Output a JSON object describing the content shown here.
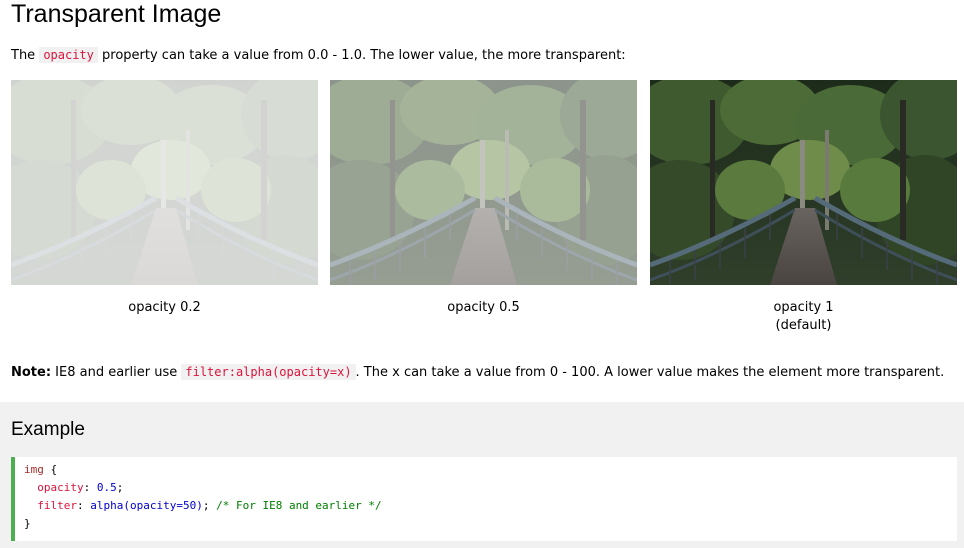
{
  "page": {
    "title": "Transparent Image",
    "intro_before": "The ",
    "intro_code": "opacity",
    "intro_after": " property can take a value from 0.0 - 1.0. The lower value, the more transparent:"
  },
  "images": [
    {
      "opacity": 0.2,
      "caption_line1": "opacity 0.2",
      "caption_line2": ""
    },
    {
      "opacity": 0.5,
      "caption_line1": "opacity 0.5",
      "caption_line2": ""
    },
    {
      "opacity": 1.0,
      "caption_line1": "opacity 1",
      "caption_line2": "(default)"
    }
  ],
  "note": {
    "label": "Note:",
    "text_before": " IE8 and earlier use ",
    "code": "filter:alpha(opacity=x)",
    "text_after": ". The x can take a value from 0 - 100. A lower value makes the element more transparent."
  },
  "example": {
    "title": "Example",
    "line1_selector": "img",
    "line1_brace": " {",
    "line2_indent": "  ",
    "line2_prop": "opacity",
    "line2_colon": ": ",
    "line2_val": "0.5",
    "line2_end": ";",
    "line3_indent": "  ",
    "line3_prop": "filter",
    "line3_colon": ": ",
    "line3_val": "alpha(opacity=50)",
    "line3_semi": "; ",
    "line3_comment": "/* For IE8 and earlier */",
    "line4": "}"
  },
  "colors": {
    "code_accent": "#dc143c",
    "example_border": "#4caf50",
    "example_bg": "#f1f1f1"
  }
}
